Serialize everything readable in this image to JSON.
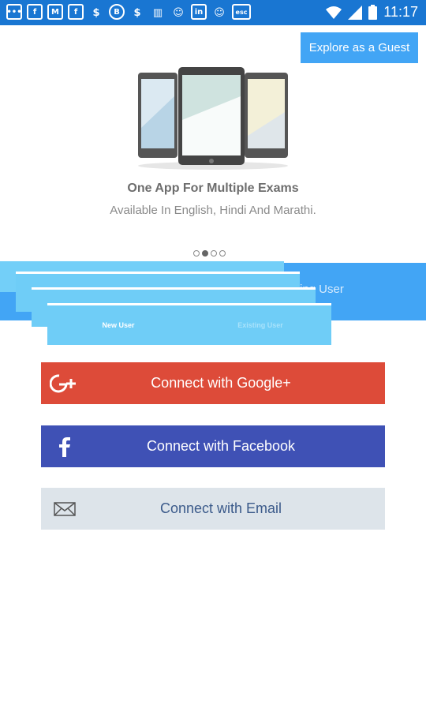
{
  "status_bar": {
    "time": "11:17",
    "icons": [
      "chat-icon",
      "facebook-icon",
      "gmail-icon",
      "facebook-icon",
      "money-bag-icon",
      "bitcoin-icon",
      "money-bag-icon",
      "sim-card-icon",
      "cat-icon",
      "linkedin-icon",
      "cat-icon",
      "esc-icon",
      "wifi-icon",
      "signal-icon",
      "battery-icon"
    ]
  },
  "guest_button": {
    "label": "Explore as a Guest"
  },
  "hero": {
    "title": "One App For Multiple Exams",
    "subtitle": "Available In English, Hindi And Marathi."
  },
  "pager": {
    "count": 4,
    "active_index": 1
  },
  "tabs": {
    "new_user": "New User",
    "existing_user": "Existing User",
    "existing_user_partial": "ing User"
  },
  "connect": {
    "google": {
      "label": "Connect with Google+",
      "icon": "google-plus-icon",
      "color": "#dd4b39"
    },
    "facebook": {
      "label": "Connect with Facebook",
      "icon": "facebook-icon",
      "color": "#3f51b5"
    },
    "email": {
      "label": "Connect with Email",
      "icon": "envelope-icon",
      "color": "#dde4ea"
    }
  },
  "colors": {
    "status_bar": "#1976d2",
    "accent": "#42a5f5",
    "tab_overlay": "#6fcdf7"
  }
}
